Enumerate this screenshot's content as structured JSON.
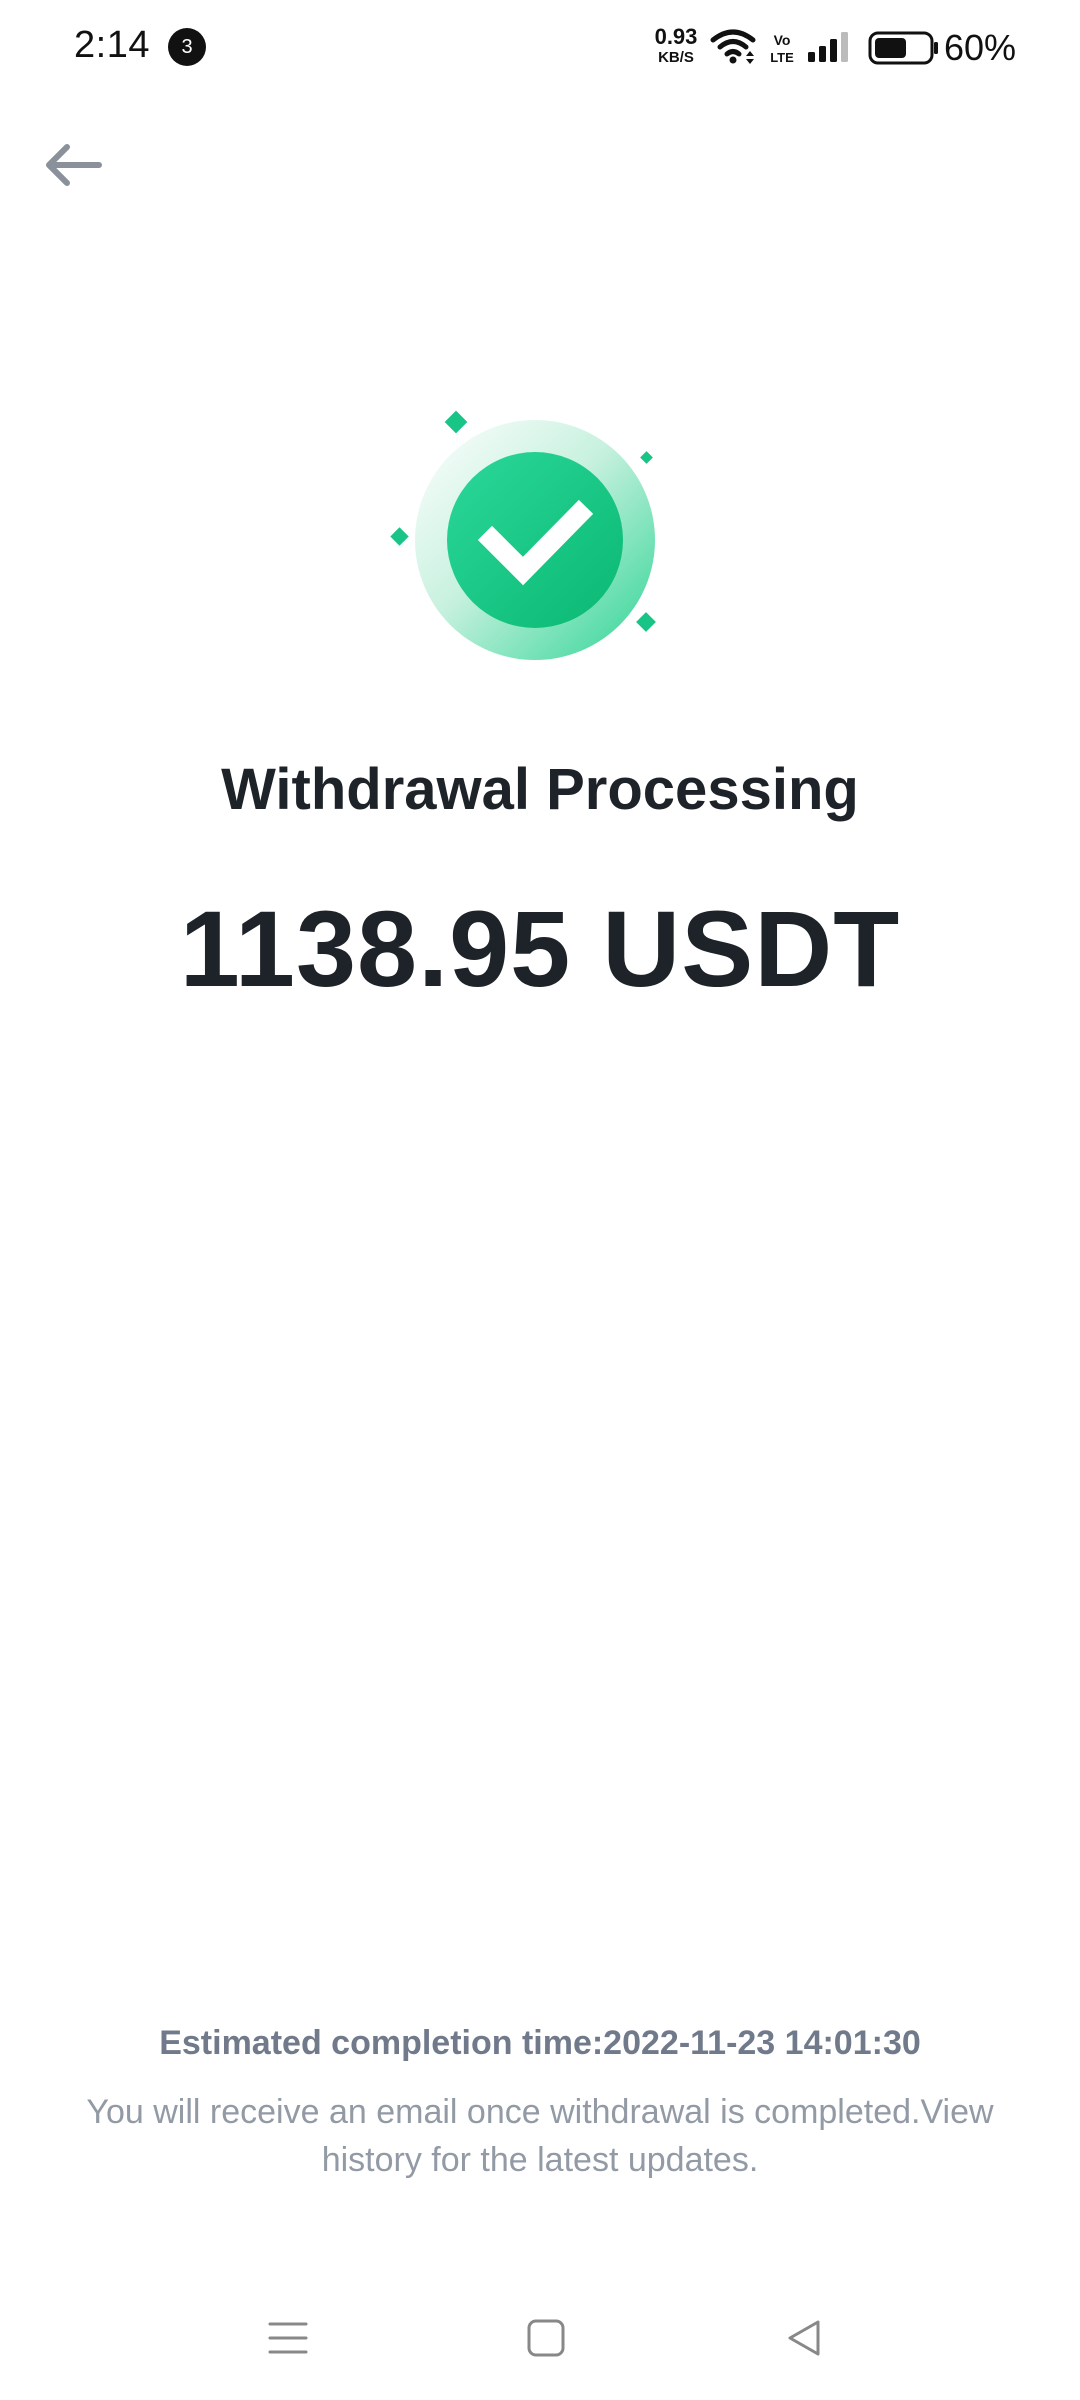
{
  "status_bar": {
    "time": "2:14",
    "notification_count": "3",
    "network_speed_value": "0.93",
    "network_speed_unit": "KB/S",
    "volte_label_top": "Vo",
    "volte_label_bottom": "LTE",
    "battery_percent": "60%",
    "battery_level": 0.6
  },
  "header": {
    "back_icon": "arrow-left-icon"
  },
  "illustration": {
    "icon": "check-circle-icon",
    "accent_color": "#0ecb81"
  },
  "result": {
    "title": "Withdrawal Processing",
    "amount": "1138.95 USDT"
  },
  "footer": {
    "estimated_completion": "Estimated completion time:2022-11-23 14:01:30",
    "email_note_prefix": "You will receive an email once withdrawal is completed.",
    "view_history_link": "View",
    "email_note_suffix": " history for the latest updates."
  },
  "nav_bar": {
    "menu_icon": "menu-icon",
    "home_icon": "home-square-icon",
    "back_icon": "back-triangle-icon"
  },
  "colors": {
    "text_primary": "#1e2329",
    "text_secondary": "#707a8a",
    "text_tertiary": "#929aa5",
    "success_green": "#0ecb81",
    "back_arrow": "#8a919b"
  }
}
